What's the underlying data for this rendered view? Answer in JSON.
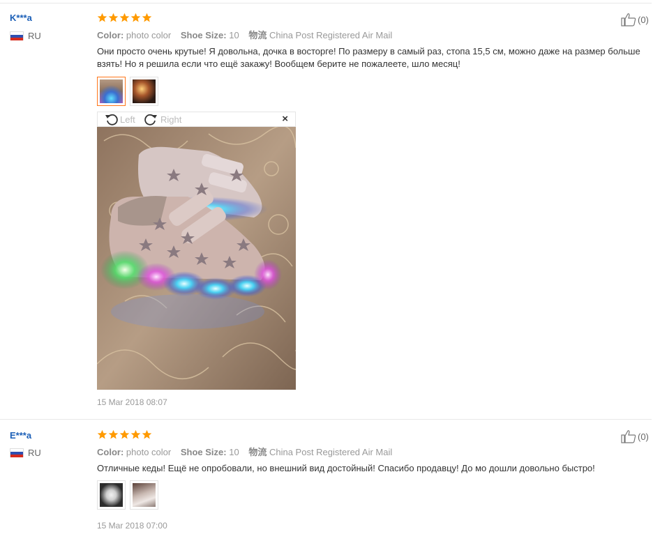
{
  "reviews": [
    {
      "user": "K***a",
      "country": "RU",
      "rating_stars": 5,
      "color_label": "Color:",
      "color_value": "photo color",
      "size_label": "Shoe Size:",
      "size_value": "10",
      "shipping_label": "物流",
      "shipping_value": "China Post Registered Air Mail",
      "text": "Они просто очень крутые! Я довольна, дочка в восторге! По размеру в самый раз, стопа 15,5 см, можно даже на размер больше взять! Но я решила если что ещё закажу! Вообщем берите не пожалеете, шло месяц!",
      "like_count": "(0)",
      "viewer": {
        "rotate_left": "Left",
        "rotate_right": "Right",
        "close": "×"
      },
      "date": "15 Mar 2018 08:07"
    },
    {
      "user": "E***a",
      "country": "RU",
      "rating_stars": 5,
      "color_label": "Color:",
      "color_value": "photo color",
      "size_label": "Shoe Size:",
      "size_value": "10",
      "shipping_label": "物流",
      "shipping_value": "China Post Registered Air Mail",
      "text": "Отличные кеды! Ещё не опробовали, но внешний вид достойный! Спасибо продавцу! До мо дошли довольно быстро!",
      "like_count": "(0)",
      "date": "15 Mar 2018 07:00"
    }
  ],
  "colors": {
    "username": "#1b5fb7",
    "star": "#ff9a00",
    "active_thumb_border": "#ff7519"
  },
  "icons": {
    "star": "star-icon",
    "like": "thumbs-up-icon",
    "rotate_left": "rotate-left-icon",
    "rotate_right": "rotate-right-icon",
    "close": "close-icon",
    "flag": "russia-flag-icon"
  }
}
